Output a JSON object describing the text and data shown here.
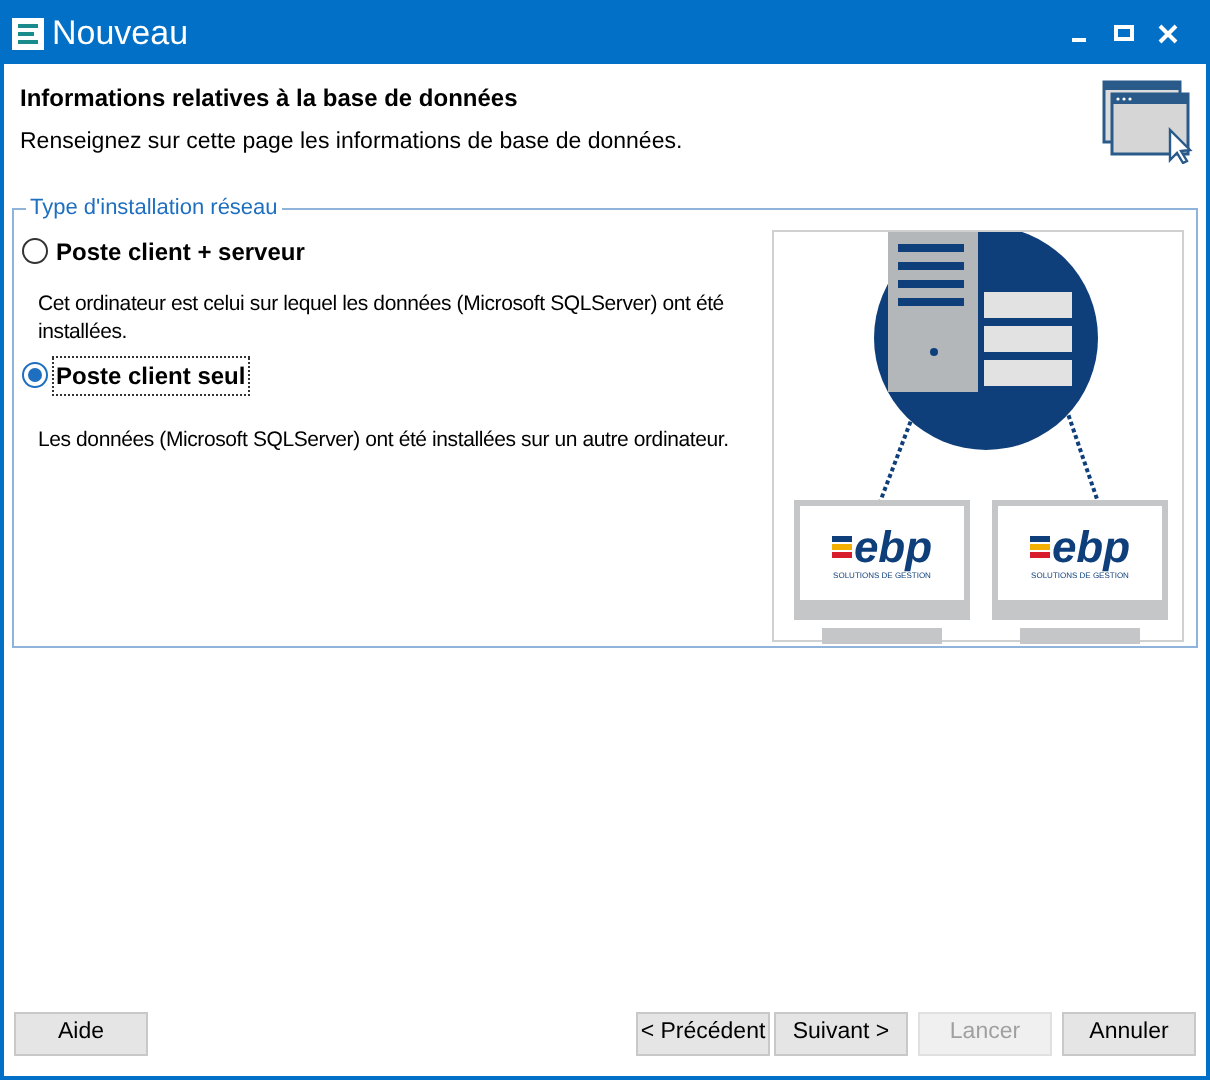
{
  "window": {
    "title": "Nouveau"
  },
  "header": {
    "title": "Informations relatives à la base de données",
    "subtitle": "Renseignez sur cette page les informations de base de données."
  },
  "group": {
    "legend": "Type d'installation réseau",
    "options": [
      {
        "label": "Poste client + serveur",
        "selected": false,
        "description": "Cet ordinateur est celui sur lequel les données (Microsoft SQLServer) ont été installées."
      },
      {
        "label": "Poste client seul",
        "selected": true,
        "description": "Les données (Microsoft SQLServer) ont été installées sur un autre ordinateur."
      }
    ],
    "illustration": {
      "monitors": [
        {
          "logo": "ebp",
          "tagline": "SOLUTIONS DE GESTION"
        },
        {
          "logo": "ebp",
          "tagline": "SOLUTIONS DE GESTION"
        }
      ]
    }
  },
  "buttons": [
    {
      "label": "Aide",
      "disabled": false
    },
    {
      "label": "< Précédent",
      "disabled": false
    },
    {
      "label": "Suivant >",
      "disabled": false
    },
    {
      "label": "Lancer",
      "disabled": true
    },
    {
      "label": "Annuler",
      "disabled": false
    }
  ]
}
